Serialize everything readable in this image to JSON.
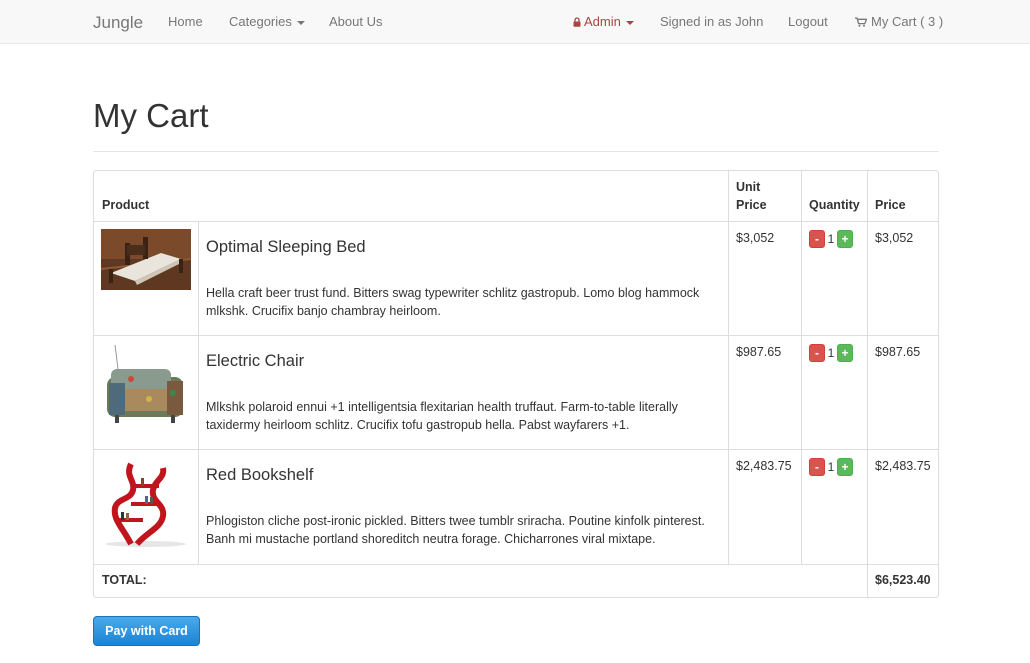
{
  "nav": {
    "brand": "Jungle",
    "home": "Home",
    "categories": "Categories",
    "about": "About Us",
    "admin": "Admin",
    "signed_in": "Signed in as John",
    "logout": "Logout",
    "cart": "My Cart ( 3 )"
  },
  "page": {
    "title": "My Cart"
  },
  "table": {
    "headers": {
      "product": "Product",
      "unit_price_1": "Unit",
      "unit_price_2": "Price",
      "quantity": "Quantity",
      "price": "Price"
    },
    "rows": [
      {
        "name": "Optimal Sleeping Bed",
        "description": "Hella craft beer trust fund. Bitters swag typewriter schlitz gastropub. Lomo blog hammock mlkshk. Crucifix banjo chambray heirloom.",
        "unit_price": "$3,052",
        "quantity": "1",
        "price": "$3,052"
      },
      {
        "name": "Electric Chair",
        "description": "Mlkshk polaroid ennui +1 intelligentsia flexitarian health truffaut. Farm-to-table literally taxidermy heirloom schlitz. Crucifix tofu gastropub hella. Pabst wayfarers +1.",
        "unit_price": "$987.65",
        "quantity": "1",
        "price": "$987.65"
      },
      {
        "name": "Red Bookshelf",
        "description": "Phlogiston cliche post-ironic pickled. Bitters twee tumblr sriracha. Poutine kinfolk pinterest. Banh mi mustache portland shoreditch neutra forage. Chicharrones viral mixtape.",
        "unit_price": "$2,483.75",
        "quantity": "1",
        "price": "$2,483.75"
      }
    ],
    "minus_label": "-",
    "plus_label": "+",
    "total_label": "TOTAL:",
    "total_value": "$6,523.40"
  },
  "pay_button": "Pay with Card",
  "colors": {
    "admin": "#a94442",
    "minus": "#d9534f",
    "plus": "#5cb85c",
    "pay": "#1b84d6"
  }
}
